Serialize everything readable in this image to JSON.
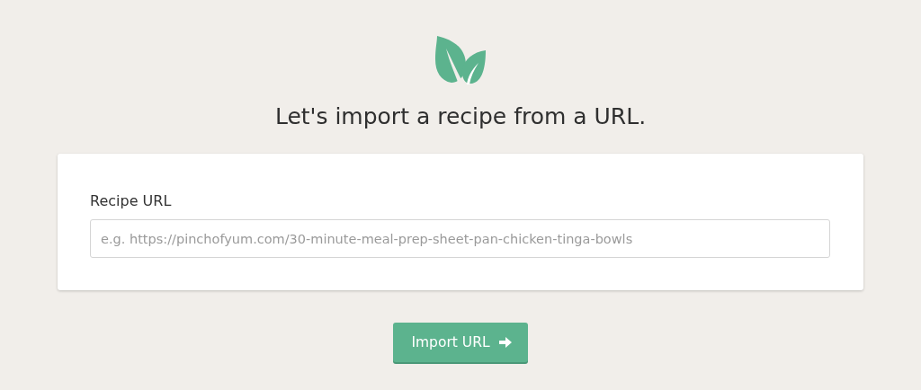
{
  "heading": "Let's import a recipe from a URL.",
  "form": {
    "label": "Recipe URL",
    "placeholder": "e.g. https://pinchofyum.com/30-minute-meal-prep-sheet-pan-chicken-tinga-bowls"
  },
  "button": {
    "label": "Import URL"
  }
}
